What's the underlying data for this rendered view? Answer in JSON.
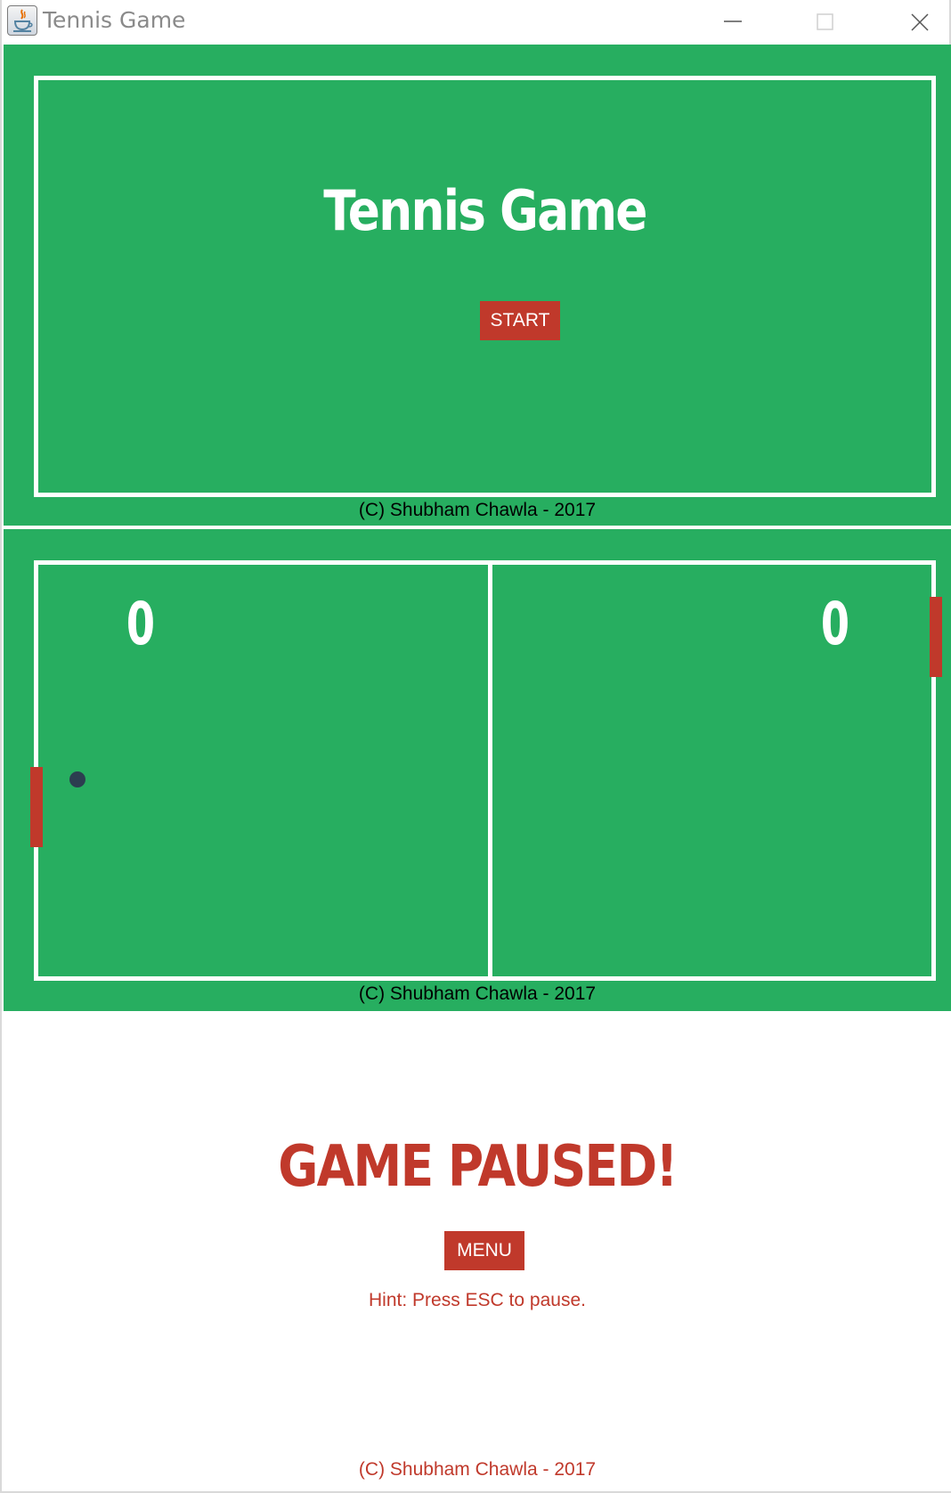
{
  "window": {
    "title": "Tennis Game",
    "icon": "java-cup-icon",
    "controls": [
      "minimize-icon",
      "maximize-icon",
      "close-icon"
    ]
  },
  "menu_screen": {
    "heading": "Tennis Game",
    "start_label": "START",
    "copyright": "(C) Shubham Chawla - 2017"
  },
  "game_screen": {
    "left_score": "0",
    "right_score": "0",
    "copyright": "(C) Shubham Chawla - 2017"
  },
  "pause_screen": {
    "heading": "GAME PAUSED!",
    "menu_label": "MENU",
    "hint": "Hint: Press ESC to pause.",
    "copyright": "(C) Shubham Chawla - 2017"
  },
  "colors": {
    "court_green": "#27ae60",
    "accent_red": "#c0392b",
    "ball": "#2c3e50",
    "line_white": "#ffffff"
  }
}
